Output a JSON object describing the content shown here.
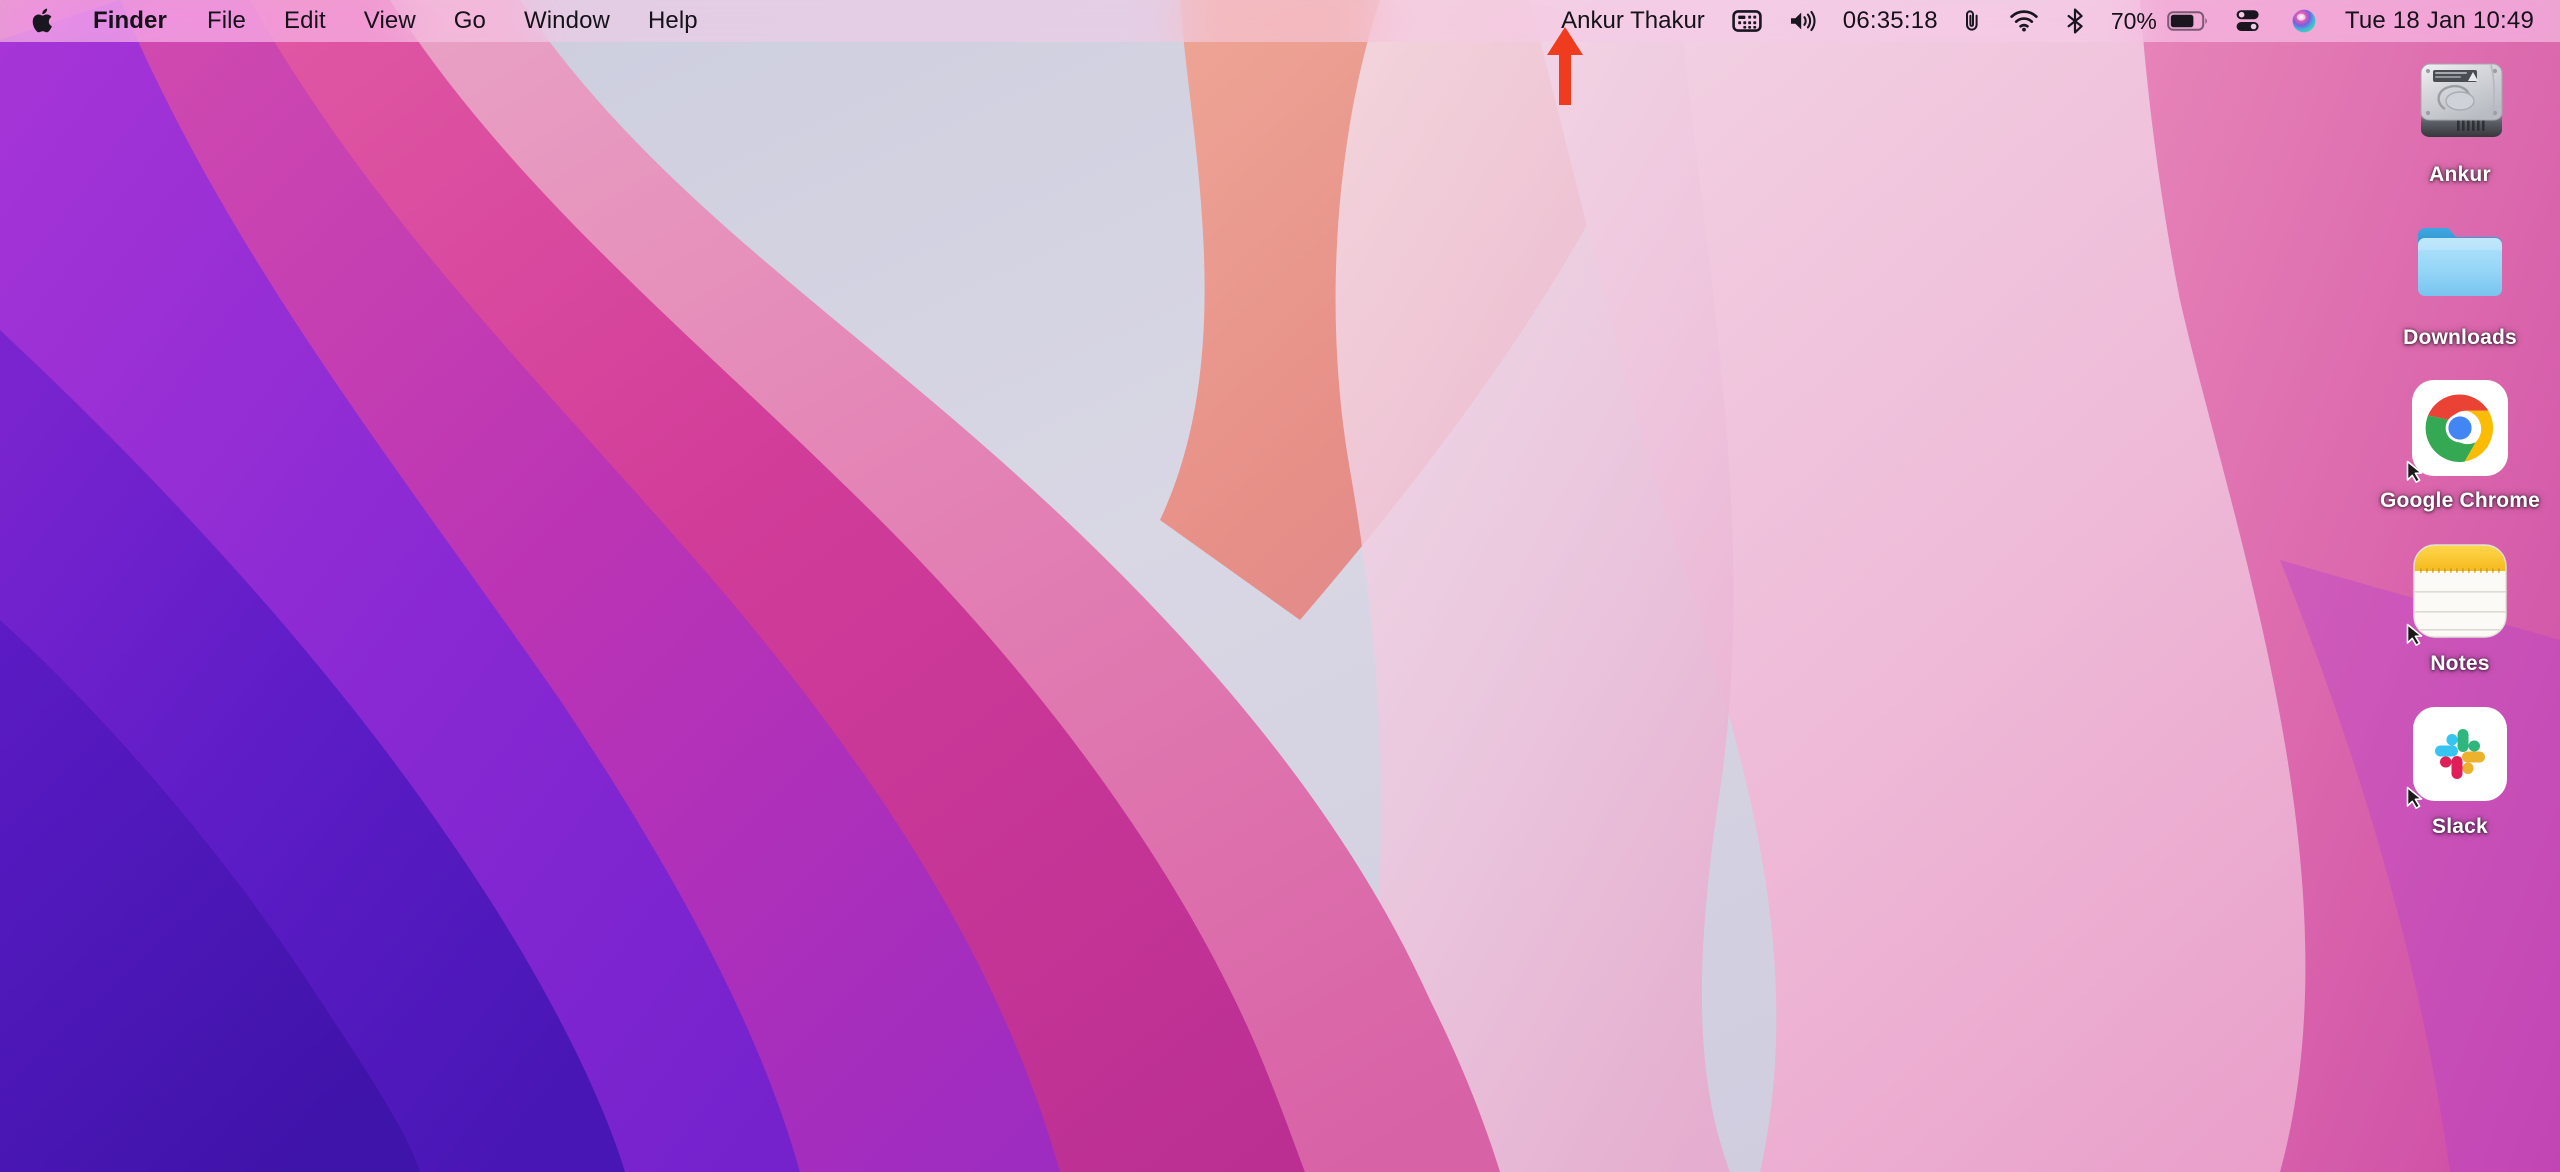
{
  "menubar": {
    "apple_logo": "",
    "left_items": [
      {
        "label": "Finder",
        "bold": true
      },
      {
        "label": "File",
        "bold": false
      },
      {
        "label": "Edit",
        "bold": false
      },
      {
        "label": "View",
        "bold": false
      },
      {
        "label": "Go",
        "bold": false
      },
      {
        "label": "Window",
        "bold": false
      },
      {
        "label": "Help",
        "bold": false
      }
    ],
    "right_items": {
      "user_name": "Ankur Thakur",
      "input_source_icon": "keyboard-input-icon",
      "volume_icon": "volume-speaker-icon",
      "timer": "06:35:18",
      "clipboard_icon": "paperclip-icon",
      "wifi_icon": "wifi-icon",
      "bluetooth_icon": "bluetooth-icon",
      "battery_percent": "70%",
      "battery_icon": "battery-icon",
      "control_center_icon": "control-center-icon",
      "siri_icon": "siri-icon",
      "datetime": "Tue 18 Jan  10:49"
    },
    "background_color": "#f0cde4"
  },
  "desktop": {
    "icons": [
      {
        "label": "Ankur",
        "icon": "hard-drive-icon",
        "alias": false
      },
      {
        "label": "Downloads",
        "icon": "folder-icon",
        "alias": false
      },
      {
        "label": "Google Chrome",
        "icon": "google-chrome-icon",
        "alias": true
      },
      {
        "label": "Notes",
        "icon": "notes-app-icon",
        "alias": true
      },
      {
        "label": "Slack",
        "icon": "slack-app-icon",
        "alias": true
      }
    ]
  },
  "annotation": {
    "arrow_color": "#f03c1e",
    "arrow_direction": "up",
    "points_at": "Ankur Thakur"
  },
  "colors": {
    "wallpaper_pink": "#e86ba8",
    "wallpaper_magenta": "#c8369b",
    "wallpaper_purple": "#7b27cf",
    "wallpaper_deep_purple": "#4b18b8",
    "wallpaper_light": "#d7d9e6",
    "wallpaper_salmon": "#e79285",
    "menubar_text": "#15121a",
    "icon_label_text": "#ffffff",
    "annotation_red": "#f03c1e"
  }
}
